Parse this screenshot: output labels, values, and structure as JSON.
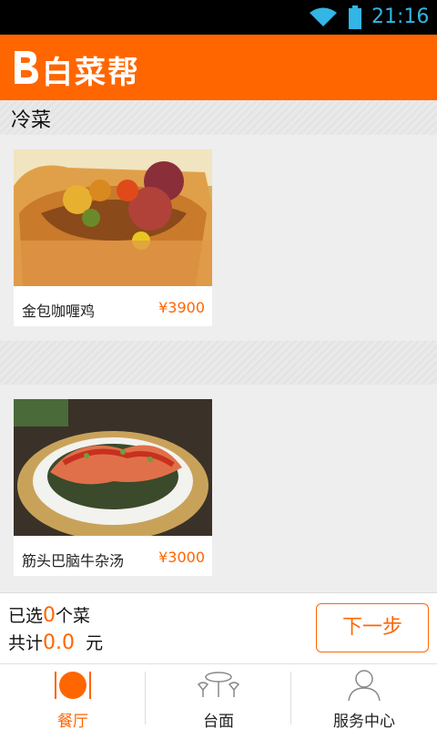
{
  "status_bar": {
    "time": "21:16",
    "icons": [
      "wifi-icon",
      "battery-icon"
    ]
  },
  "app_bar": {
    "brand": "白菜帮",
    "logo_icon": "letter-b-logo-icon"
  },
  "sections": [
    {
      "label": "冷菜"
    },
    {
      "label": ""
    }
  ],
  "dishes": [
    {
      "name": "金包咖喱鸡",
      "price": "¥3900"
    },
    {
      "name": "筋头巴脑牛杂汤",
      "price": "¥3000"
    }
  ],
  "summary": {
    "selected_prefix": "已选",
    "selected_count": "0",
    "selected_suffix": "个菜",
    "total_prefix": "共计",
    "total_amount": "0.0",
    "total_suffix": "元",
    "next_button": "下一步"
  },
  "tabs": [
    {
      "label": "餐厅",
      "icon": "restaurant-plate-icon",
      "active": true
    },
    {
      "label": "台面",
      "icon": "table-icon",
      "active": false
    },
    {
      "label": "服务中心",
      "icon": "user-service-icon",
      "active": false
    }
  ],
  "colors": {
    "accent": "#ff6600",
    "status_icon": "#33b5e5"
  }
}
